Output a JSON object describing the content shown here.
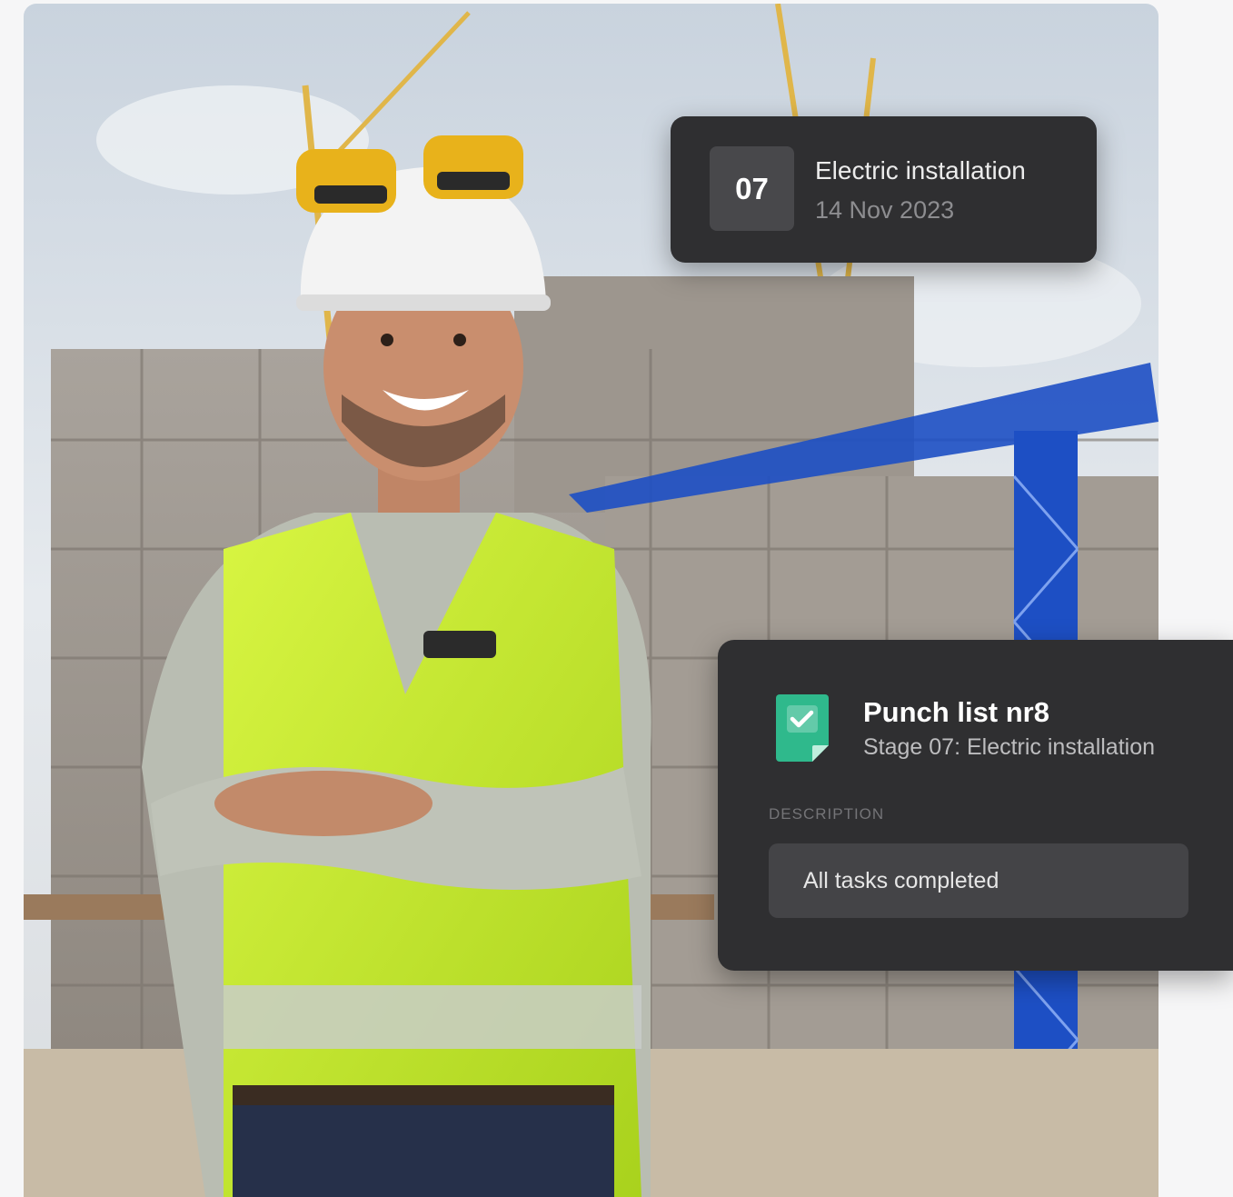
{
  "colors": {
    "card_bg": "#2f2f31",
    "accent_green": "#2fb98c",
    "sky": "#dce3ea",
    "crane_blue": "#1d4fc4",
    "vest_yellow": "#c9ef2a"
  },
  "photo": {
    "subject": "construction-worker-photo"
  },
  "stage_card": {
    "number": "07",
    "title": "Electric installation",
    "date": "14 Nov 2023"
  },
  "punch_card": {
    "icon": "checklist-document-icon",
    "title": "Punch list nr8",
    "subtitle": "Stage 07: Electric installation",
    "description_label": "DESCRIPTION",
    "description_value": "All tasks completed"
  }
}
